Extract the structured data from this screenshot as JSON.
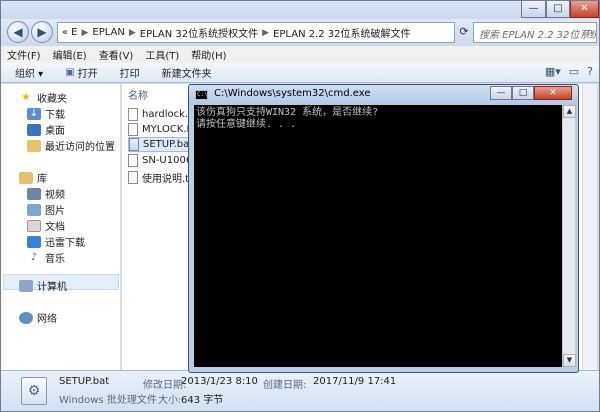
{
  "window": {
    "caption_buttons": {
      "minimize": "—",
      "maximize": "□",
      "close": "✕"
    }
  },
  "address": {
    "chevrons": "«",
    "segments": [
      "E",
      "EPLAN",
      "EPLAN 32位系统授权文件",
      "EPLAN 2.2 32位系统破解文件"
    ],
    "search_placeholder": "搜索 EPLAN 2.2 32位系统..."
  },
  "menu": [
    "文件(F)",
    "编辑(E)",
    "查看(V)",
    "工具(T)",
    "帮助(H)"
  ],
  "toolbar": {
    "organize": "组织 ▾",
    "open": "打开",
    "print": "打印",
    "new_folder": "新建文件夹"
  },
  "nav": {
    "favorites": "收藏夹",
    "favorites_items": [
      "下载",
      "桌面",
      "最近访问的位置"
    ],
    "libraries": "库",
    "library_items": [
      "视频",
      "图片",
      "文档",
      "迅雷下载",
      "音乐"
    ],
    "computer": "计算机",
    "network": "网络"
  },
  "filelist": {
    "column_name": "名称",
    "files": [
      "hardlock.sys",
      "MYLOCK.FSY",
      "SETUP.bat",
      "SN-U10066...",
      "使用说明.txt"
    ],
    "selected_index": 2
  },
  "cmd": {
    "title": "C:\\Windows\\system32\\cmd.exe",
    "icon_text": "C:\\",
    "lines": [
      "该伤真狗只支持WIN32 系统，是否继续?",
      "请按任意键继续. . ."
    ]
  },
  "details": {
    "filename": "SETUP.bat",
    "type": "Windows 批处理文件",
    "modified_label": "修改日期:",
    "modified_value": "2013/1/23 8:10",
    "created_label": "创建日期:",
    "created_value": "2017/11/9 17:41",
    "size_label": "大小:",
    "size_value": "643 字节"
  }
}
